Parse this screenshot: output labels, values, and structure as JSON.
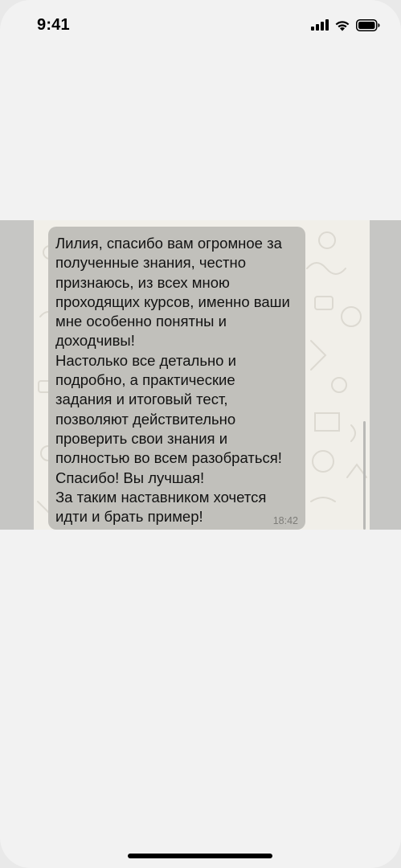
{
  "status_bar": {
    "time": "9:41"
  },
  "icons": {
    "signal": "cellular-signal-icon",
    "wifi": "wifi-icon",
    "battery": "battery-icon"
  },
  "colors": {
    "screen_background": "#f2f2f2",
    "photo_frame": "#c6c6c4",
    "chat_wallpaper": "#f1efe9",
    "message_bubble": "#c1c0bb"
  },
  "message": {
    "lines": [
      "Лилия, спасибо вам огромное за",
      "полученные знания, честно",
      "признаюсь, из всех мною",
      "проходящих курсов, именно ваши",
      "мне особенно понятны и",
      "доходчивы!",
      "Настолько все детально и",
      "подробно, а практические",
      "задания и итоговый тест,",
      "позволяют действительно",
      "проверить свои знания и",
      "полностью во всем разобраться!",
      "Спасибо! Вы лучшая!",
      "За таким наставником хочется",
      "идти и брать пример!"
    ],
    "time": "18:42"
  }
}
